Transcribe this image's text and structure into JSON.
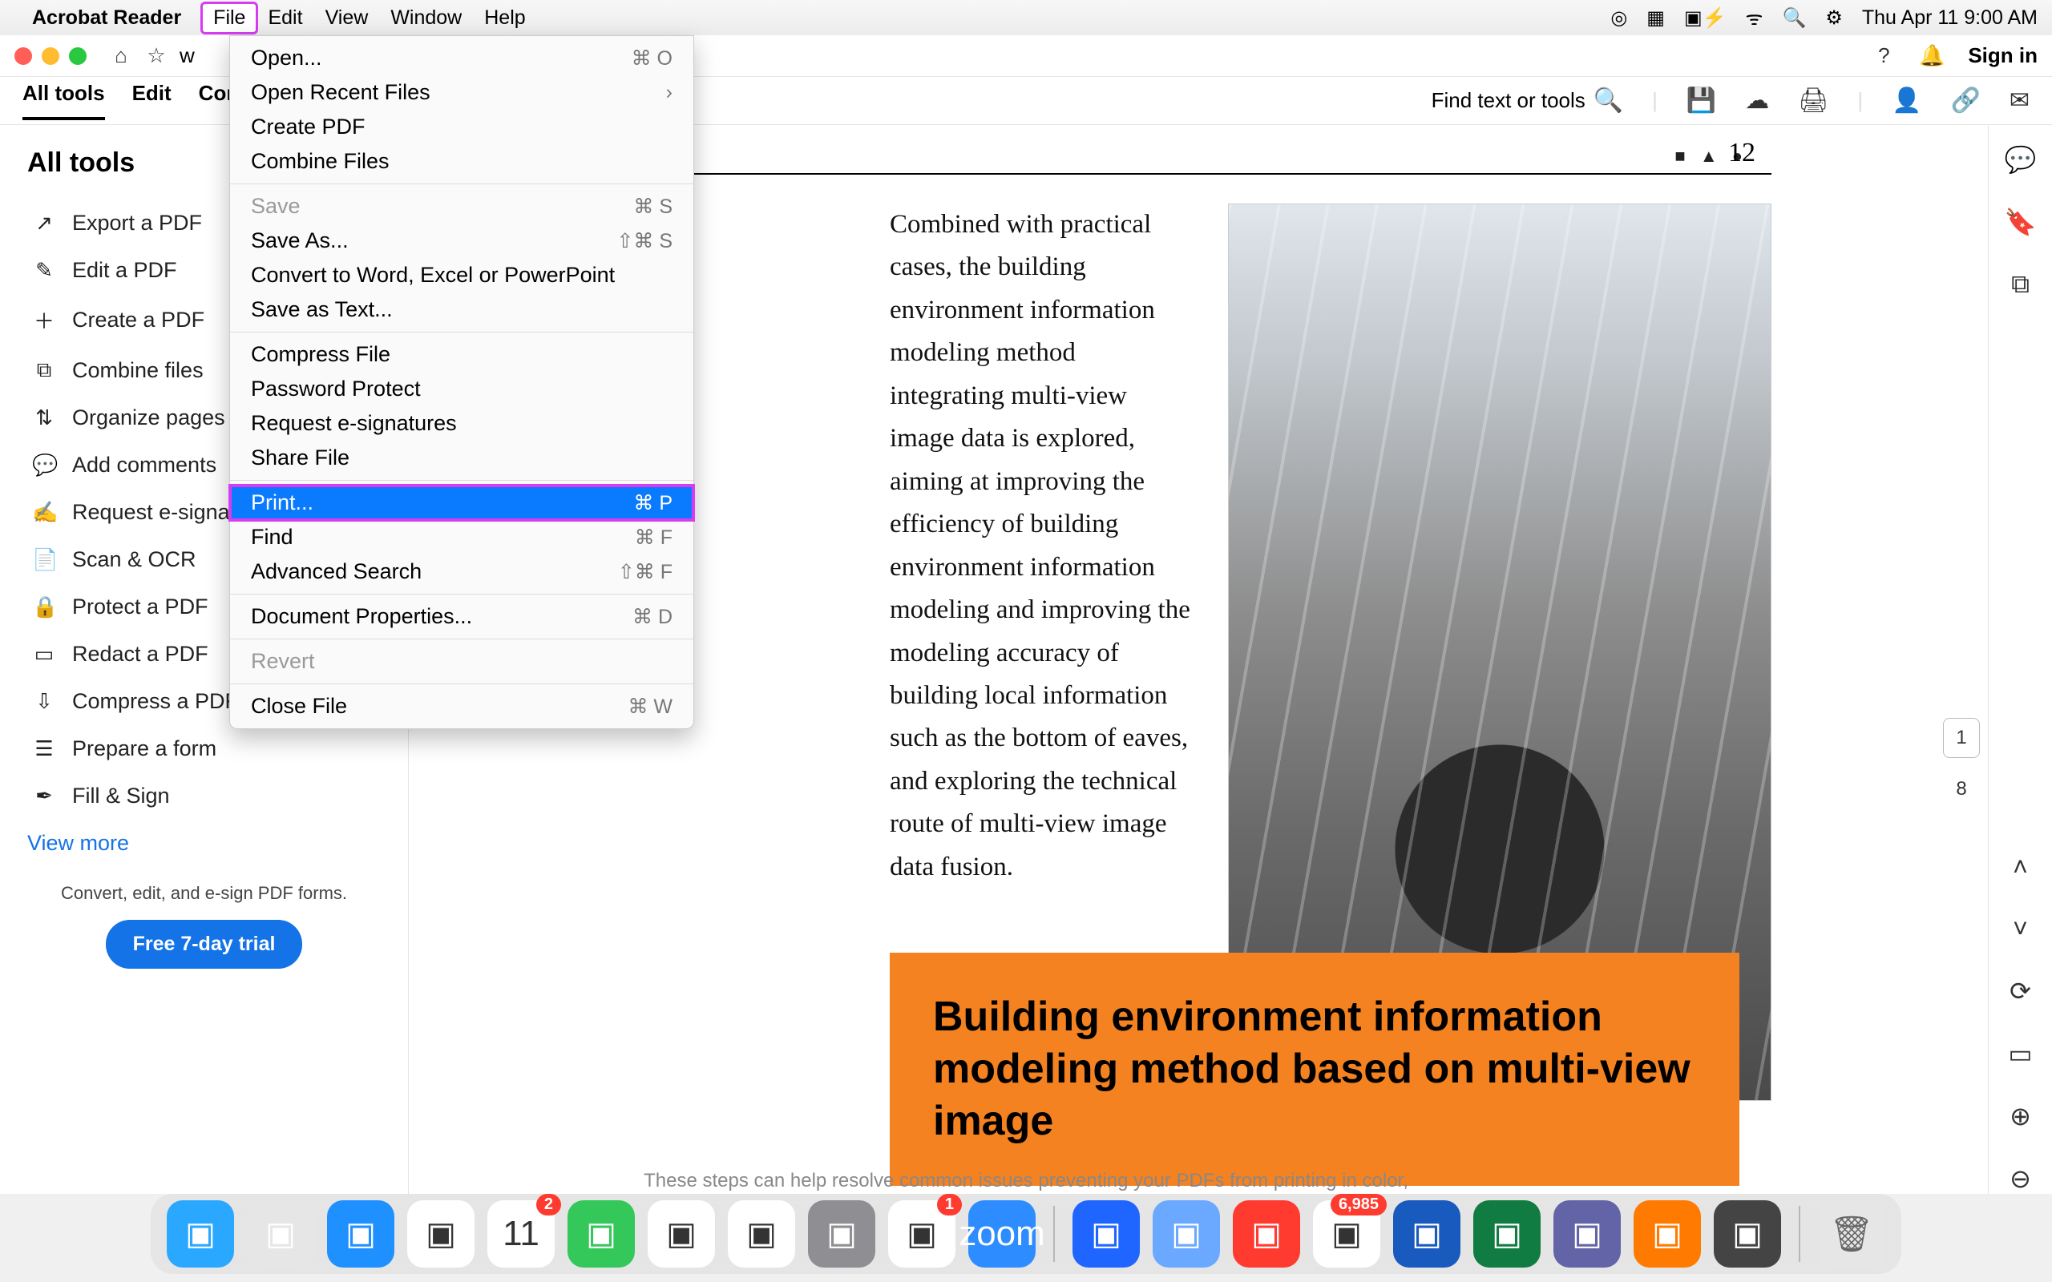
{
  "menubar": {
    "app": "Acrobat Reader",
    "items": [
      "File",
      "Edit",
      "View",
      "Window",
      "Help"
    ],
    "clock": "Thu Apr 11  9:00 AM"
  },
  "dropdown": {
    "groups": [
      [
        {
          "label": "Open...",
          "shortcut": "⌘ O"
        },
        {
          "label": "Open Recent Files",
          "shortcut": "›",
          "submenu": true
        },
        {
          "label": "Create PDF"
        },
        {
          "label": "Combine Files"
        }
      ],
      [
        {
          "label": "Save",
          "shortcut": "⌘ S",
          "disabled": true
        },
        {
          "label": "Save As...",
          "shortcut": "⇧⌘ S"
        },
        {
          "label": "Convert to Word, Excel or PowerPoint"
        },
        {
          "label": "Save as Text..."
        }
      ],
      [
        {
          "label": "Compress File"
        },
        {
          "label": "Password Protect"
        },
        {
          "label": "Request e-signatures"
        },
        {
          "label": "Share File"
        }
      ],
      [
        {
          "label": "Print...",
          "shortcut": "⌘ P",
          "selected": true
        }
      ],
      [
        {
          "label": "Find",
          "shortcut": "⌘ F"
        },
        {
          "label": "Advanced Search",
          "shortcut": "⇧⌘ F"
        }
      ],
      [
        {
          "label": "Document Properties...",
          "shortcut": "⌘ D"
        }
      ],
      [
        {
          "label": "Revert",
          "disabled": true
        }
      ],
      [
        {
          "label": "Close File",
          "shortcut": "⌘ W"
        }
      ]
    ]
  },
  "winchrome": {
    "tab_text": "w",
    "signin": "Sign in"
  },
  "toolbar": {
    "tabs": [
      "All tools",
      "Edit",
      "Conv"
    ],
    "find_label": "Find text or tools"
  },
  "sidebar": {
    "title": "All tools",
    "items": [
      {
        "icon": "↗",
        "label": "Export a PDF"
      },
      {
        "icon": "✎",
        "label": "Edit a PDF"
      },
      {
        "icon": "＋",
        "label": "Create a PDF"
      },
      {
        "icon": "⧉",
        "label": "Combine files"
      },
      {
        "icon": "⇅",
        "label": "Organize pages"
      },
      {
        "icon": "💬",
        "label": "Add comments"
      },
      {
        "icon": "✍",
        "label": "Request e-signatu"
      },
      {
        "icon": "📄",
        "label": "Scan & OCR"
      },
      {
        "icon": "🔒",
        "label": "Protect a PDF"
      },
      {
        "icon": "▭",
        "label": "Redact a PDF"
      },
      {
        "icon": "⇩",
        "label": "Compress a PDF"
      },
      {
        "icon": "☰",
        "label": "Prepare a form"
      },
      {
        "icon": "✒",
        "label": "Fill & Sign"
      }
    ],
    "view_more": "View more",
    "promo": "Convert, edit, and e-sign PDF forms.",
    "trial": "Free 7-day trial"
  },
  "document": {
    "page_number": "12",
    "body": "Combined with practical cases, the building environment information modeling method integrating multi-view image data is explored, aiming at improving the efficiency of building environment information modeling and improving the modeling accuracy of building local information such as the bottom of eaves, and exploring the technical route of multi-view image data fusion.",
    "orange_title": "Building environment information modeling method based on multi-view image",
    "truncated_hint": "These steps can help resolve common issues preventing your PDFs from printing in color,"
  },
  "page_nav": {
    "current": "1",
    "total": "8"
  },
  "dock": {
    "apps": [
      {
        "name": "finder",
        "bg": "#2aa8ff"
      },
      {
        "name": "launchpad",
        "bg": "#e6e6e6"
      },
      {
        "name": "safari",
        "bg": "#1e90ff"
      },
      {
        "name": "photos",
        "bg": "#fff"
      },
      {
        "name": "calendar",
        "bg": "#fff",
        "badge": "2",
        "text": "11"
      },
      {
        "name": "messages",
        "bg": "#34c759"
      },
      {
        "name": "notes",
        "bg": "#fff"
      },
      {
        "name": "freeform",
        "bg": "#fff"
      },
      {
        "name": "settings",
        "bg": "#8e8e93"
      },
      {
        "name": "chrome",
        "bg": "#fff",
        "badge": "1"
      },
      {
        "name": "zoom",
        "bg": "#2d8cff",
        "text": "zoom"
      }
    ],
    "apps2": [
      {
        "name": "jamf",
        "bg": "#1e66ff"
      },
      {
        "name": "preview",
        "bg": "#6aa9ff"
      },
      {
        "name": "acrobat",
        "bg": "#ff3b30"
      },
      {
        "name": "mail",
        "bg": "#fff",
        "badge": "6,985"
      },
      {
        "name": "word",
        "bg": "#185abd"
      },
      {
        "name": "excel",
        "bg": "#107c41"
      },
      {
        "name": "teams",
        "bg": "#6264a7"
      },
      {
        "name": "wave",
        "bg": "#ff7a00"
      },
      {
        "name": "keychain",
        "bg": "#444"
      }
    ],
    "trash": {
      "name": "trash",
      "bg": "#e6e6e6"
    }
  }
}
